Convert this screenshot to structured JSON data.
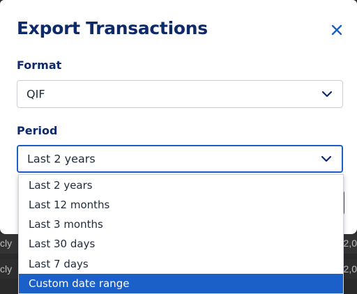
{
  "dialog": {
    "title": "Export Transactions",
    "close_icon": "close-icon"
  },
  "format": {
    "label": "Format",
    "value": "QIF"
  },
  "period": {
    "label": "Period",
    "value": "Last 2 years",
    "options": [
      "Last 2 years",
      "Last 12 months",
      "Last 3 months",
      "Last 30 days",
      "Last 7 days",
      "Custom date range"
    ],
    "highlighted": "Custom date range"
  },
  "background": {
    "row1_left": "cly",
    "row1_right": "2,0",
    "row2_left": "cly",
    "row2_right": "2,0"
  },
  "colors": {
    "title": "#0e2a6b",
    "accent": "#1b5fc9"
  }
}
